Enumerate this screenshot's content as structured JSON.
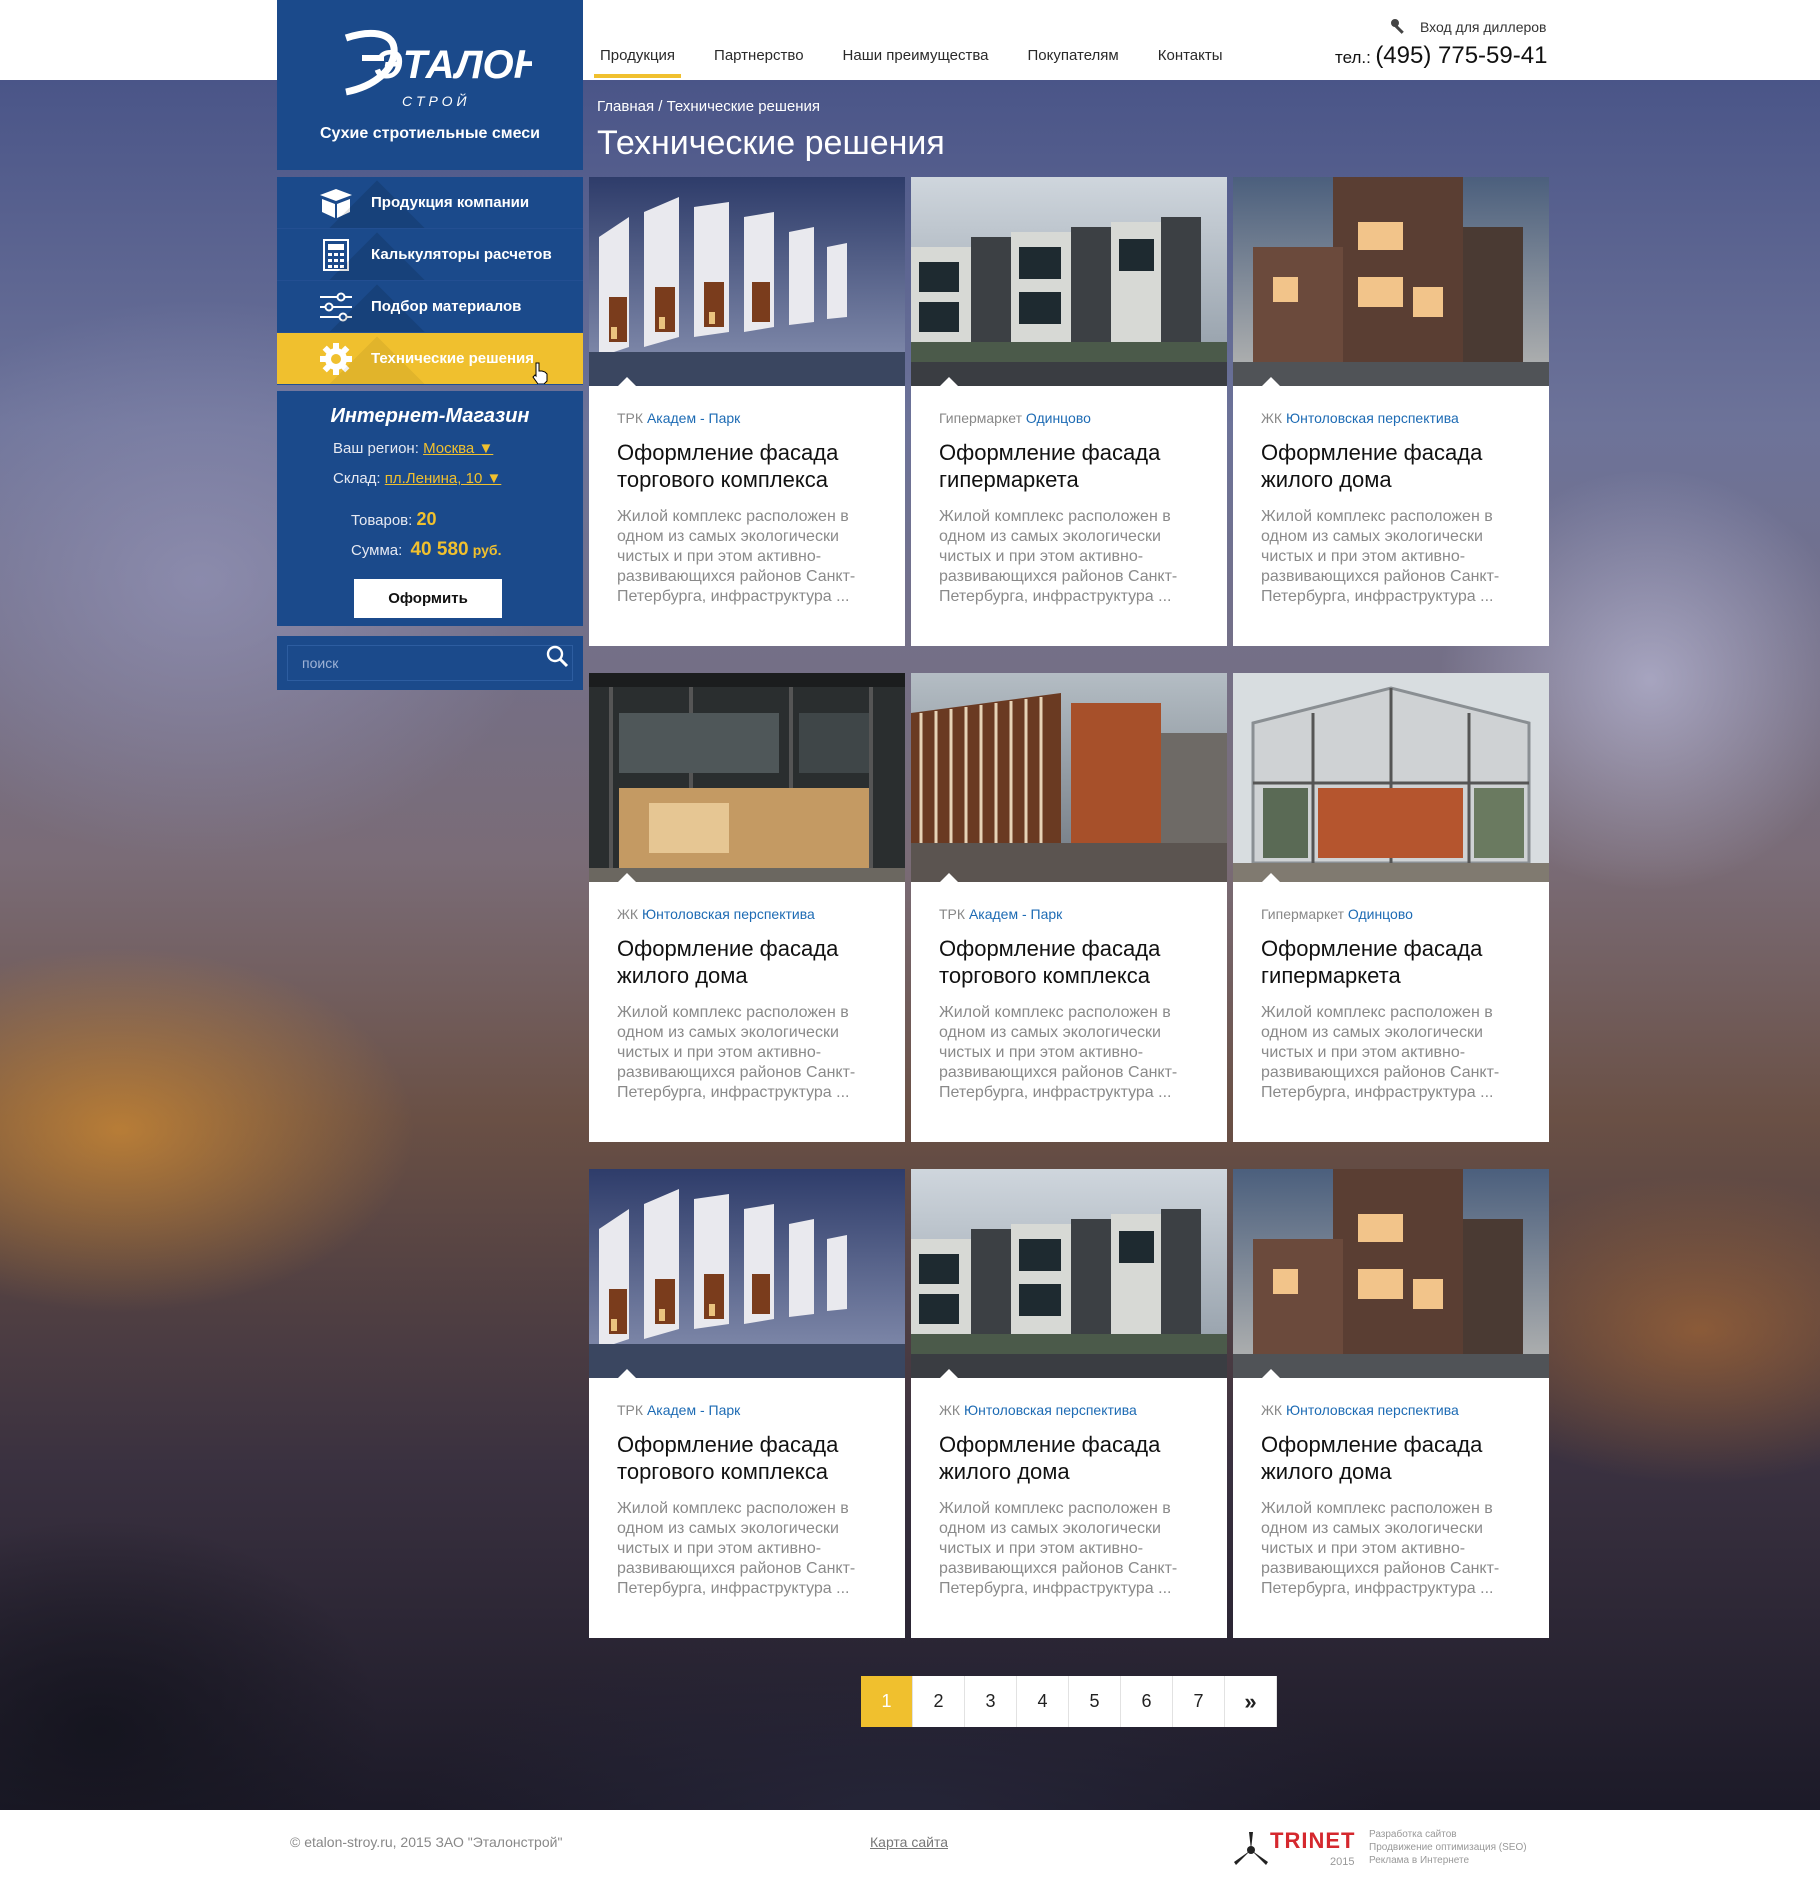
{
  "header": {
    "nav": [
      "Продукция",
      "Партнерство",
      "Наши преимущества",
      "Покупателям",
      "Контакты"
    ],
    "dealer_login": "Вход для диллеров",
    "phone_label": "тел.:",
    "phone_number": "(495) 775-59-41"
  },
  "logo": {
    "brand_top": "ЭТАЛОН",
    "brand_sub": "С Т Р О Й",
    "tagline": "Сухие стротиельные смеси"
  },
  "sidebar": {
    "items": [
      {
        "label": "Продукция компании",
        "icon": "box-icon"
      },
      {
        "label": "Калькуляторы расчетов",
        "icon": "calculator-icon"
      },
      {
        "label": "Подбор материалов",
        "icon": "sliders-icon"
      },
      {
        "label": "Технические решения",
        "icon": "gear-icon"
      }
    ]
  },
  "shop": {
    "title": "Интернет-Магазин",
    "region_label": "Ваш регион:",
    "region_value": "Москва ▼",
    "warehouse_label": "Склад:",
    "warehouse_value": "пл.Ленина, 10 ▼",
    "items_label": "Товаров:",
    "items_value": "20",
    "sum_label": "Сумма:",
    "sum_value": "40 580",
    "sum_currency": "руб.",
    "checkout": "Оформить"
  },
  "search": {
    "placeholder": "поиск"
  },
  "breadcrumb": "Главная / Технические решения",
  "page_title": "Технические решения",
  "cards": [
    {
      "type": "ТРК",
      "place": "Академ - Парк",
      "title": "Оформление фасада торгового комплекса",
      "desc": "Жилой комплекс расположен в одном из самых экологически чистых и при этом активно-развивающихся районов Санкт-Петербурга, инфраструктура ..."
    },
    {
      "type": "Гипермаркет",
      "place": "Одинцово",
      "title": "Оформление фасада гипермаркета",
      "desc": "Жилой комплекс расположен в одном из самых экологически чистых и при этом активно-развивающихся районов Санкт-Петербурга, инфраструктура ..."
    },
    {
      "type": "ЖК",
      "place": "Юнтоловская перспектива",
      "title": "Оформление фасада жилого дома",
      "desc": "Жилой комплекс расположен в одном из самых экологически чистых и при этом активно-развивающихся районов Санкт-Петербурга, инфраструктура ..."
    },
    {
      "type": "ЖК",
      "place": "Юнтоловская перспектива",
      "title": "Оформление фасада жилого дома",
      "desc": "Жилой комплекс расположен в одном из самых экологически чистых и при этом активно-развивающихся районов Санкт-Петербурга, инфраструктура ..."
    },
    {
      "type": "ТРК",
      "place": "Академ - Парк",
      "title": "Оформление фасада торгового комплекса",
      "desc": "Жилой комплекс расположен в одном из самых экологически чистых и при этом активно-развивающихся районов Санкт-Петербурга, инфраструктура ..."
    },
    {
      "type": "Гипермаркет",
      "place": "Одинцово",
      "title": "Оформление фасада гипермаркета",
      "desc": "Жилой комплекс расположен в одном из самых экологически чистых и при этом активно-развивающихся районов Санкт-Петербурга, инфраструктура ..."
    },
    {
      "type": "ТРК",
      "place": "Академ - Парк",
      "title": "Оформление фасада торгового комплекса",
      "desc": "Жилой комплекс расположен в одном из самых экологически чистых и при этом активно-развивающихся районов Санкт-Петербурга, инфраструктура ..."
    },
    {
      "type": "ЖК",
      "place": "Юнтоловская перспектива",
      "title": "Оформление фасада жилого дома",
      "desc": "Жилой комплекс расположен в одном из самых экологически чистых и при этом активно-развивающихся районов Санкт-Петербурга, инфраструктура ..."
    },
    {
      "type": "ЖК",
      "place": "Юнтоловская перспектива",
      "title": "Оформление фасада жилого дома",
      "desc": "Жилой комплекс расположен в одном из самых экологически чистых и при этом активно-развивающихся районов Санкт-Петербурга, инфраструктура ..."
    }
  ],
  "pagination": [
    "1",
    "2",
    "3",
    "4",
    "5",
    "6",
    "7",
    "»"
  ],
  "footer": {
    "copyright": "© etalon-stroy.ru, 2015 ЗАО \"Эталонстрой\"",
    "sitemap": "Карта сайта",
    "dev_brand": "TRINET",
    "dev_year": "2015",
    "dev_lines": [
      "Разработка сайтов",
      "Продвижение оптимизация (SEO)",
      "Реклама в Интернете"
    ]
  },
  "colors": {
    "brand_blue": "#1b4a8b",
    "accent_yellow": "#f0c02e",
    "link_blue": "#1d6bb4"
  }
}
